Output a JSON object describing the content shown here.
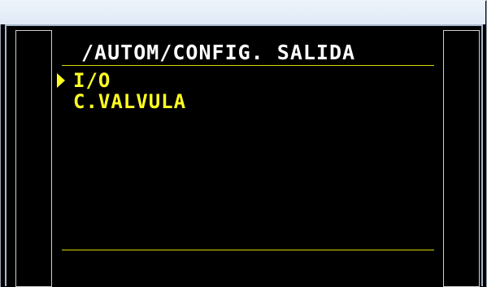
{
  "header": {
    "title": "/AUTOM/CONFIG. SALIDA"
  },
  "menu": {
    "selected_index": 0,
    "items": [
      {
        "label": "I/O"
      },
      {
        "label": "C.VALVULA"
      }
    ]
  },
  "colors": {
    "screen_background": "#000000",
    "title_text": "#ffffff",
    "menu_text": "#ffff22",
    "divider": "#d8d800"
  },
  "icons": {
    "cursor": "triangle-right-icon"
  }
}
